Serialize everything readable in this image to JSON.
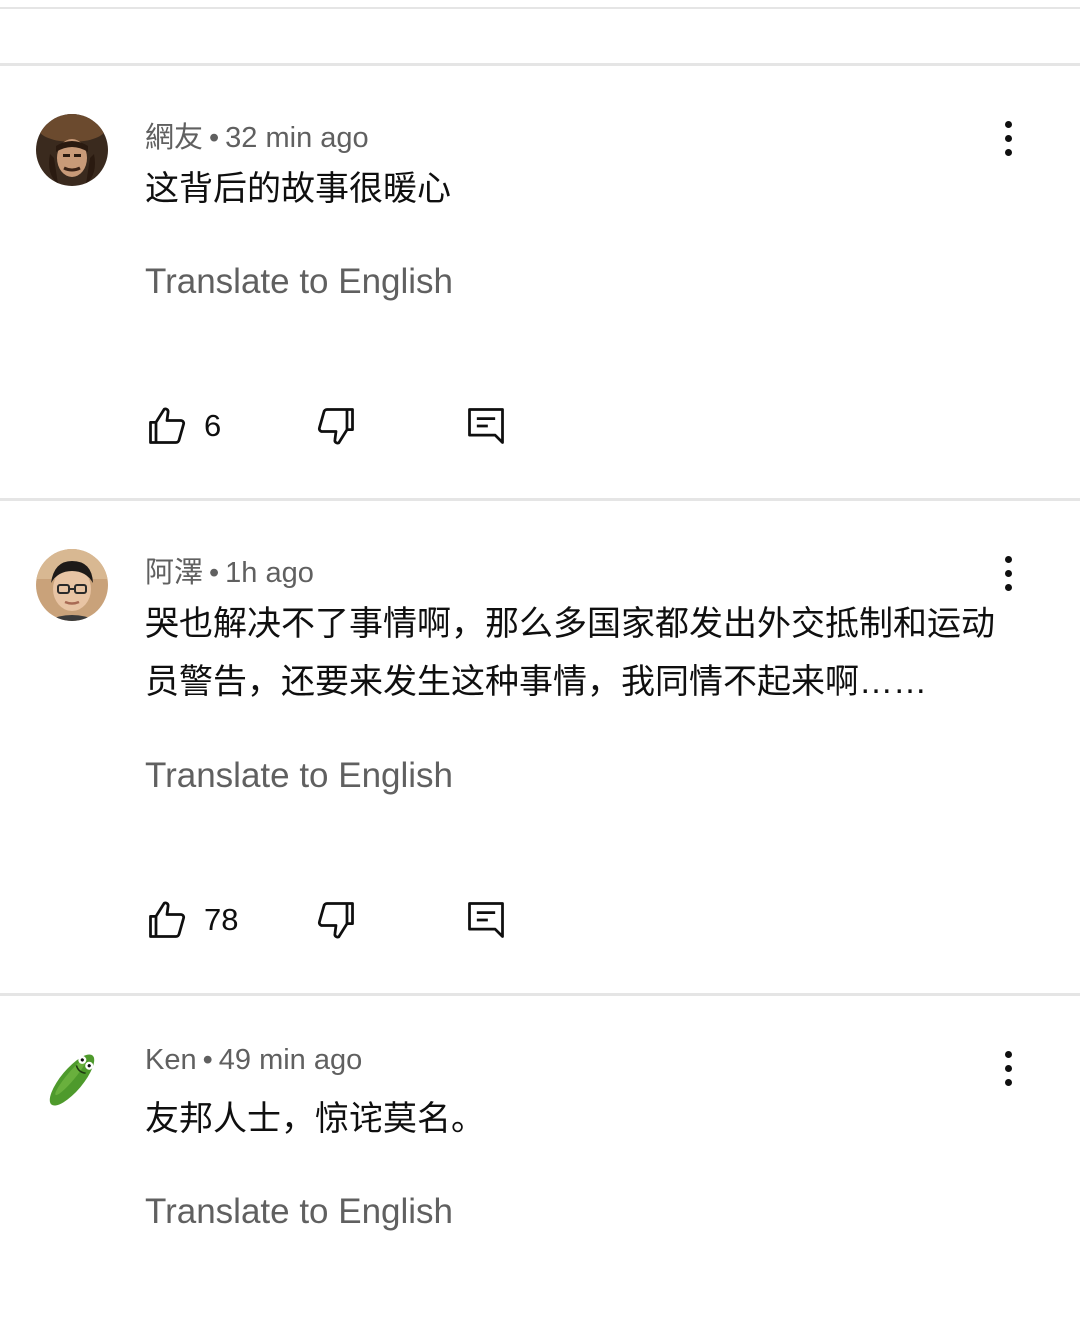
{
  "comments": [
    {
      "author": "網友",
      "separator": "•",
      "time": "32 min ago",
      "text": "这背后的故事很暖心",
      "translate": "Translate to English",
      "likes": "6",
      "avatar_icon": "avatar-man-hat-icon"
    },
    {
      "author": "阿澤",
      "separator": "•",
      "time": "1h ago",
      "text": "哭也解决不了事情啊，那么多国家都发出外交抵制和运动员警告，还要来发生这种事情，我同情不起来啊……",
      "translate": "Translate to English",
      "likes": "78",
      "avatar_icon": "avatar-man-glasses-icon"
    },
    {
      "author": "Ken",
      "separator": "•",
      "time": "49 min ago",
      "text": "友邦人士，惊诧莫名。",
      "translate": "Translate to English",
      "avatar_icon": "avatar-pickle-icon"
    }
  ]
}
